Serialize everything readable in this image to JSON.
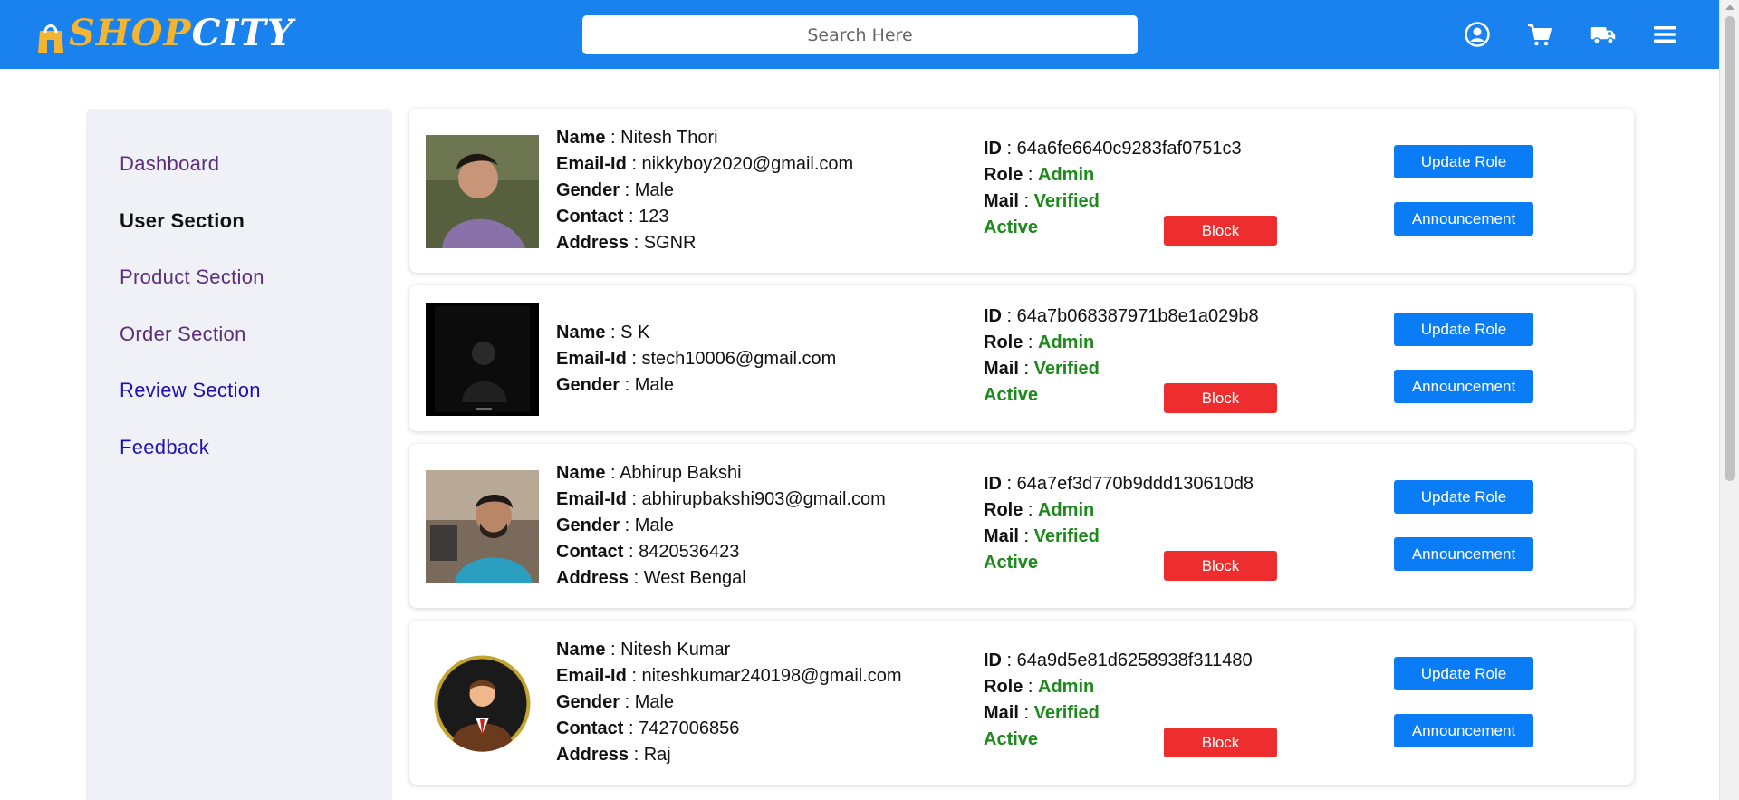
{
  "brand": {
    "logo_shop": "SHOP",
    "logo_city": "CITY"
  },
  "search": {
    "placeholder": "Search Here"
  },
  "header_icons": [
    "user-circle-icon",
    "cart-icon",
    "truck-icon",
    "menu-icon"
  ],
  "colors": {
    "header": "#1a82ee",
    "block": "#ee2d2f",
    "action": "#0a7cf5",
    "status_green": "#1b8a1b"
  },
  "sidebar": {
    "items": [
      {
        "label": "Dashboard"
      },
      {
        "label": "User Section"
      },
      {
        "label": "Product Section"
      },
      {
        "label": "Order Section"
      },
      {
        "label": "Review Section"
      },
      {
        "label": "Feedback"
      }
    ]
  },
  "labels": {
    "name": "Name",
    "email": "Email-Id",
    "gender": "Gender",
    "contact": "Contact",
    "address": "Address",
    "id": "ID",
    "role": "Role",
    "mail": "Mail",
    "sep": " : "
  },
  "buttons": {
    "block": "Block",
    "update_role": "Update Role",
    "announcement": "Announcement"
  },
  "users": [
    {
      "name": "Nitesh Thori",
      "email": "nikkyboy2020@gmail.com",
      "gender": "Male",
      "contact": "123",
      "address": "SGNR",
      "id": "64a6fe6640c9283faf0751c3",
      "role": "Admin",
      "mail": "Verified",
      "status": "Active"
    },
    {
      "name": "S K",
      "email": "stech10006@gmail.com",
      "gender": "Male",
      "id": "64a7b068387971b8e1a029b8",
      "role": "Admin",
      "mail": "Verified",
      "status": "Active"
    },
    {
      "name": "Abhirup Bakshi",
      "email": "abhirupbakshi903@gmail.com",
      "gender": "Male",
      "contact": "8420536423",
      "address": "West Bengal",
      "id": "64a7ef3d770b9ddd130610d8",
      "role": "Admin",
      "mail": "Verified",
      "status": "Active"
    },
    {
      "name": "Nitesh Kumar",
      "email": "niteshkumar240198@gmail.com",
      "gender": "Male",
      "contact": "7427006856",
      "address": "Raj",
      "id": "64a9d5e81d6258938f311480",
      "role": "Admin",
      "mail": "Verified",
      "status": "Active"
    }
  ]
}
